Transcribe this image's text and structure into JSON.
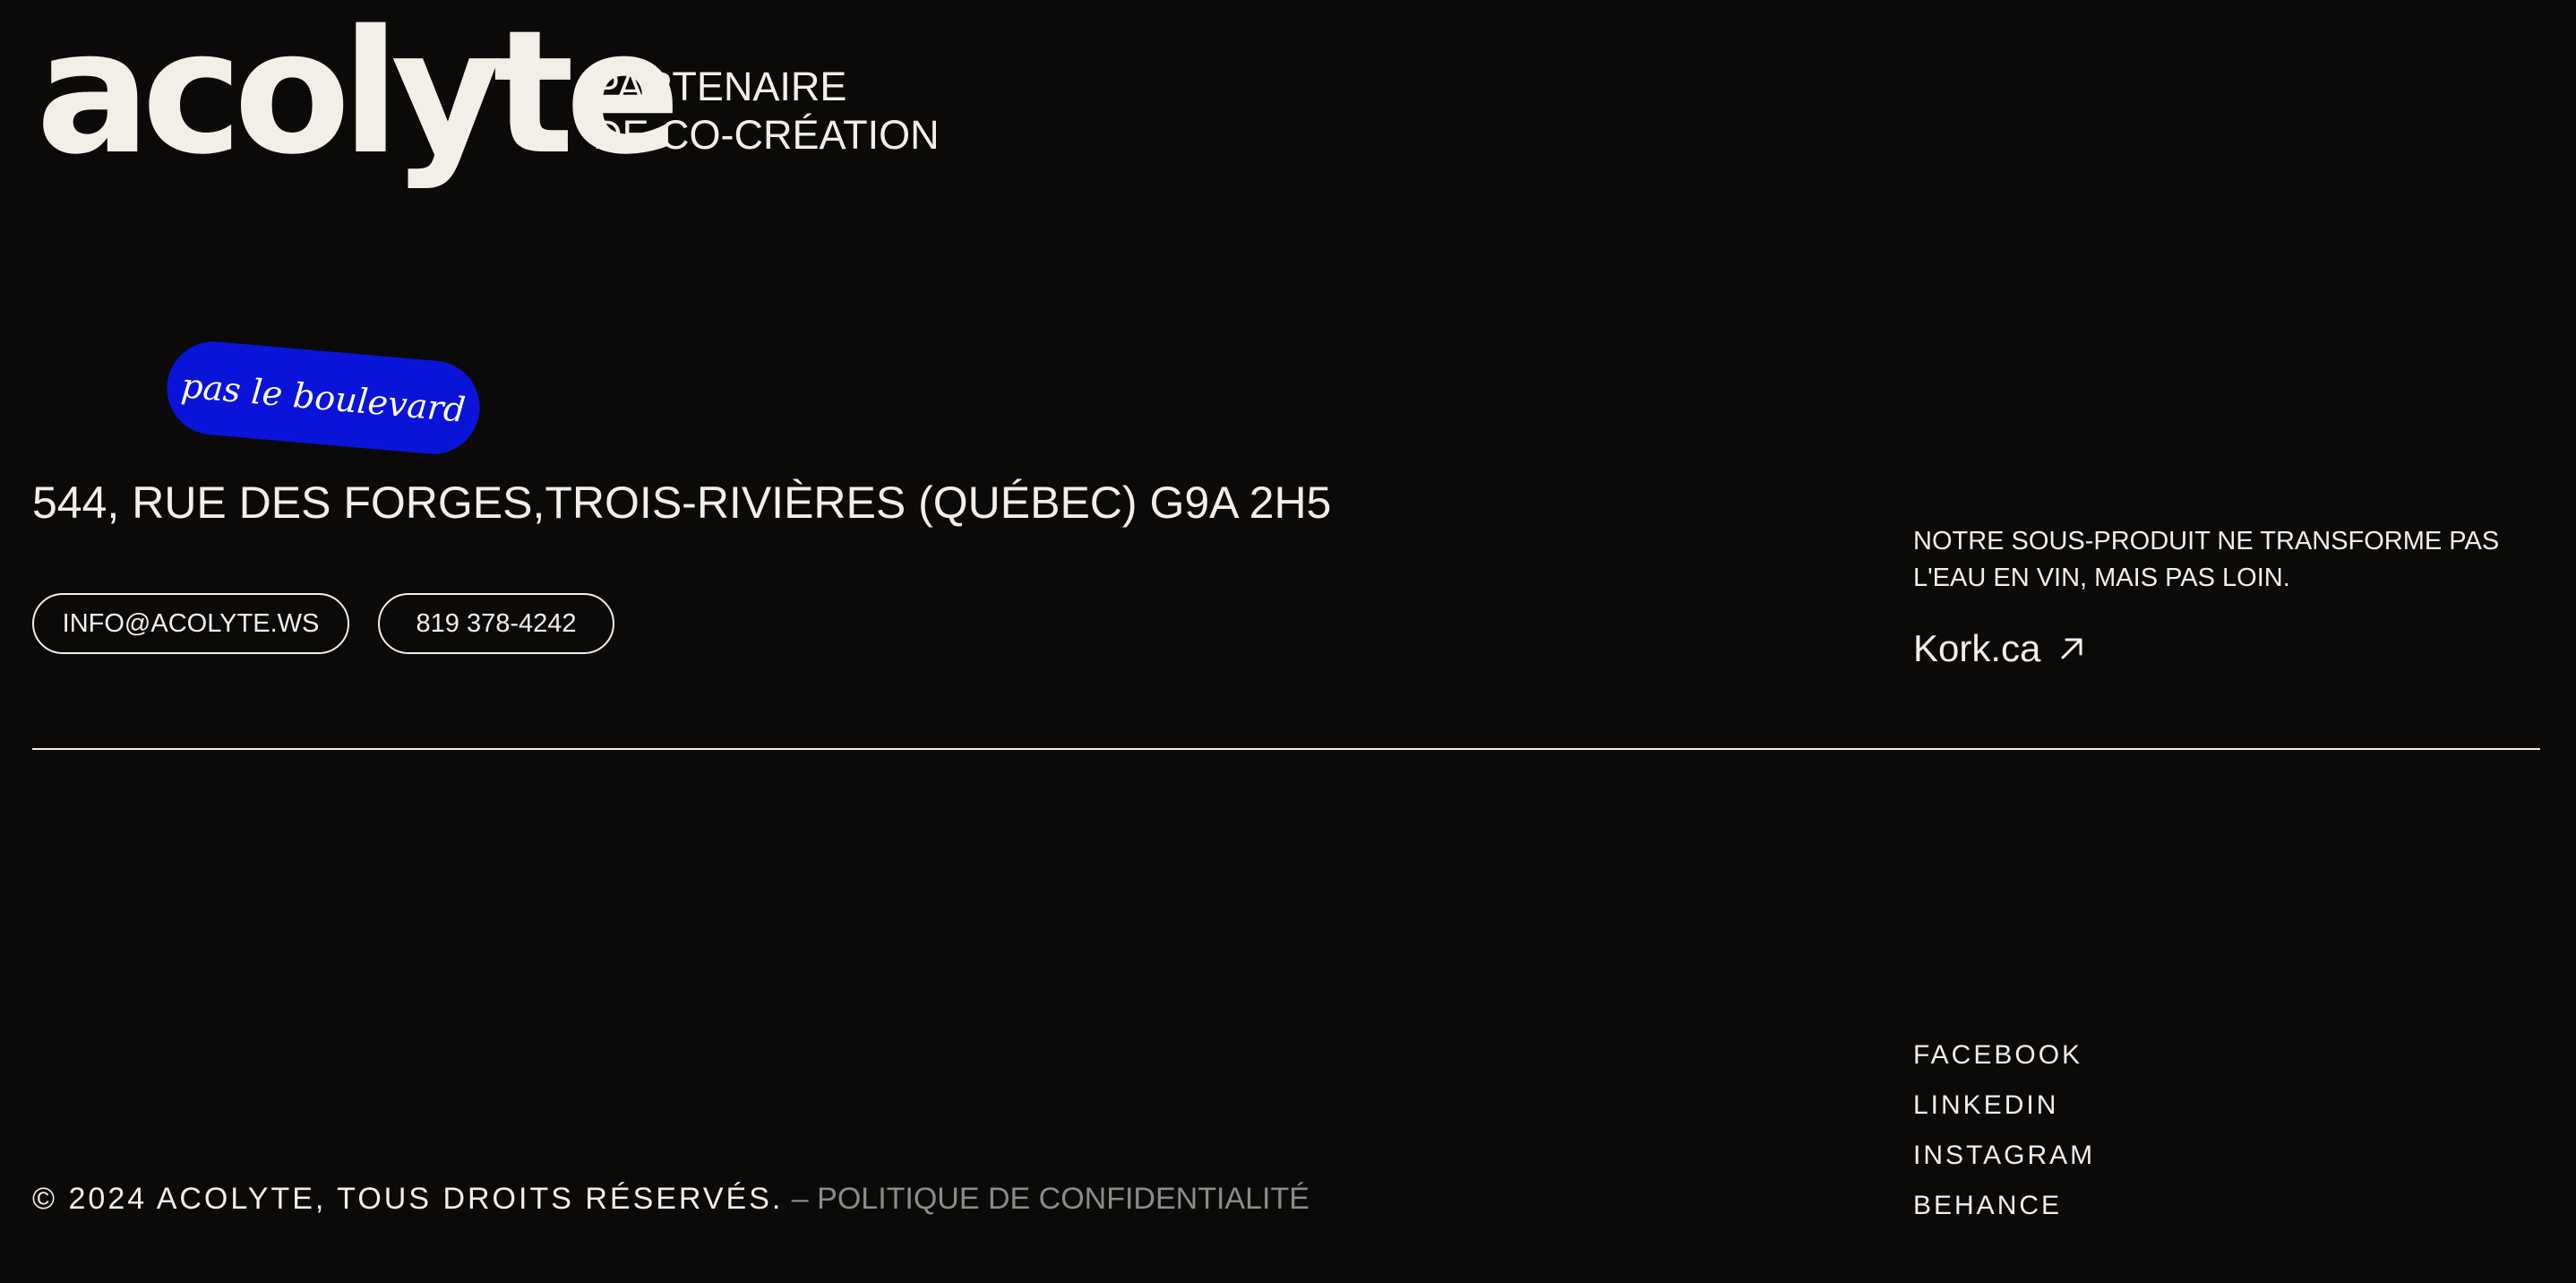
{
  "brand": {
    "logo_text": "acolyte",
    "tagline_line1": "PARTENAIRE",
    "tagline_line2": "DE CO-CRÉATION"
  },
  "badge": {
    "text": "pas le boulevard",
    "color": "#0a14d9"
  },
  "contact": {
    "address": "544, RUE DES FORGES,TROIS-RIVIÈRES (QUÉBEC) G9A 2H5",
    "email_label": "INFO@ACOLYTE.WS",
    "phone_label": "819 378-4242"
  },
  "promo": {
    "line1": "NOTRE SOUS-PRODUIT NE TRANSFORME PAS",
    "line2": "L'EAU EN VIN, MAIS PAS LOIN.",
    "link_label": "Kork.ca",
    "link_icon": "arrow-up-right-icon"
  },
  "social": {
    "items": [
      "FACEBOOK",
      "LINKEDIN",
      "INSTAGRAM",
      "BEHANCE"
    ]
  },
  "footer": {
    "copyright": "© 2024 ACOLYTE, TOUS DROITS RÉSERVÉS.",
    "privacy": " – POLITIQUE DE CONFIDENTIALITÉ"
  },
  "colors": {
    "background": "#0b0a09",
    "foreground": "#f2efe8",
    "muted": "#8d8b88"
  }
}
